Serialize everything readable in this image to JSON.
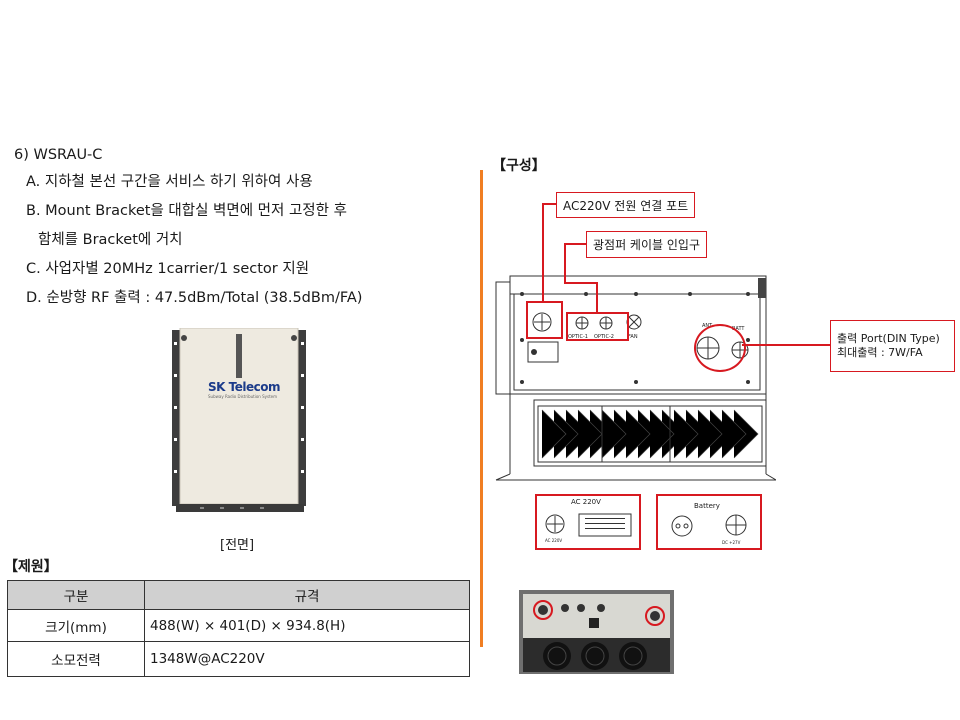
{
  "product": {
    "heading": "6) WSRAU-C",
    "items": [
      "A. 지하철 본선 구간을 서비스 하기 위하여 사용",
      "B. Mount Bracket을 대합실 벽면에 먼저 고정한 후",
      "함체를 Bracket에 거치",
      "C. 사업자별 20MHz 1carrier/1 sector 지원",
      "D. 순방향 RF 출력 : 47.5dBm/Total (38.5dBm/FA)"
    ],
    "device_brand": "SK Telecom",
    "device_sub": "Subway Radio Distribution System",
    "front_caption": "[전면]"
  },
  "spec": {
    "title": "【제원】",
    "headers": [
      "구분",
      "규격"
    ],
    "rows": [
      {
        "label": "크기(mm)",
        "value": "488(W) × 401(D) × 934.8(H)"
      },
      {
        "label": "소모전력",
        "value": "1348W@AC220V"
      }
    ]
  },
  "config": {
    "title": "【구성】",
    "callouts": {
      "ac_port": "AC220V 전원 연결 포트",
      "optic": "광점퍼 케이블 인입구",
      "output_1": "출력 Port(DIN Type)",
      "output_2": "최대출력 : 7W/FA"
    },
    "panel_labels": {
      "optic1": "OPTIC-1",
      "optic2": "OPTIC-2",
      "fan": "FAN",
      "ant": "ANT",
      "batt": "BATT"
    },
    "detail": {
      "ac_title": "AC 220V",
      "ac_small": "AC 220V",
      "battery_title": "Battery",
      "battery_small": "DC +27V"
    }
  },
  "colors": {
    "divider": "#f07e22",
    "callout_red": "#d71920",
    "table_header": "#d0d0d0"
  }
}
